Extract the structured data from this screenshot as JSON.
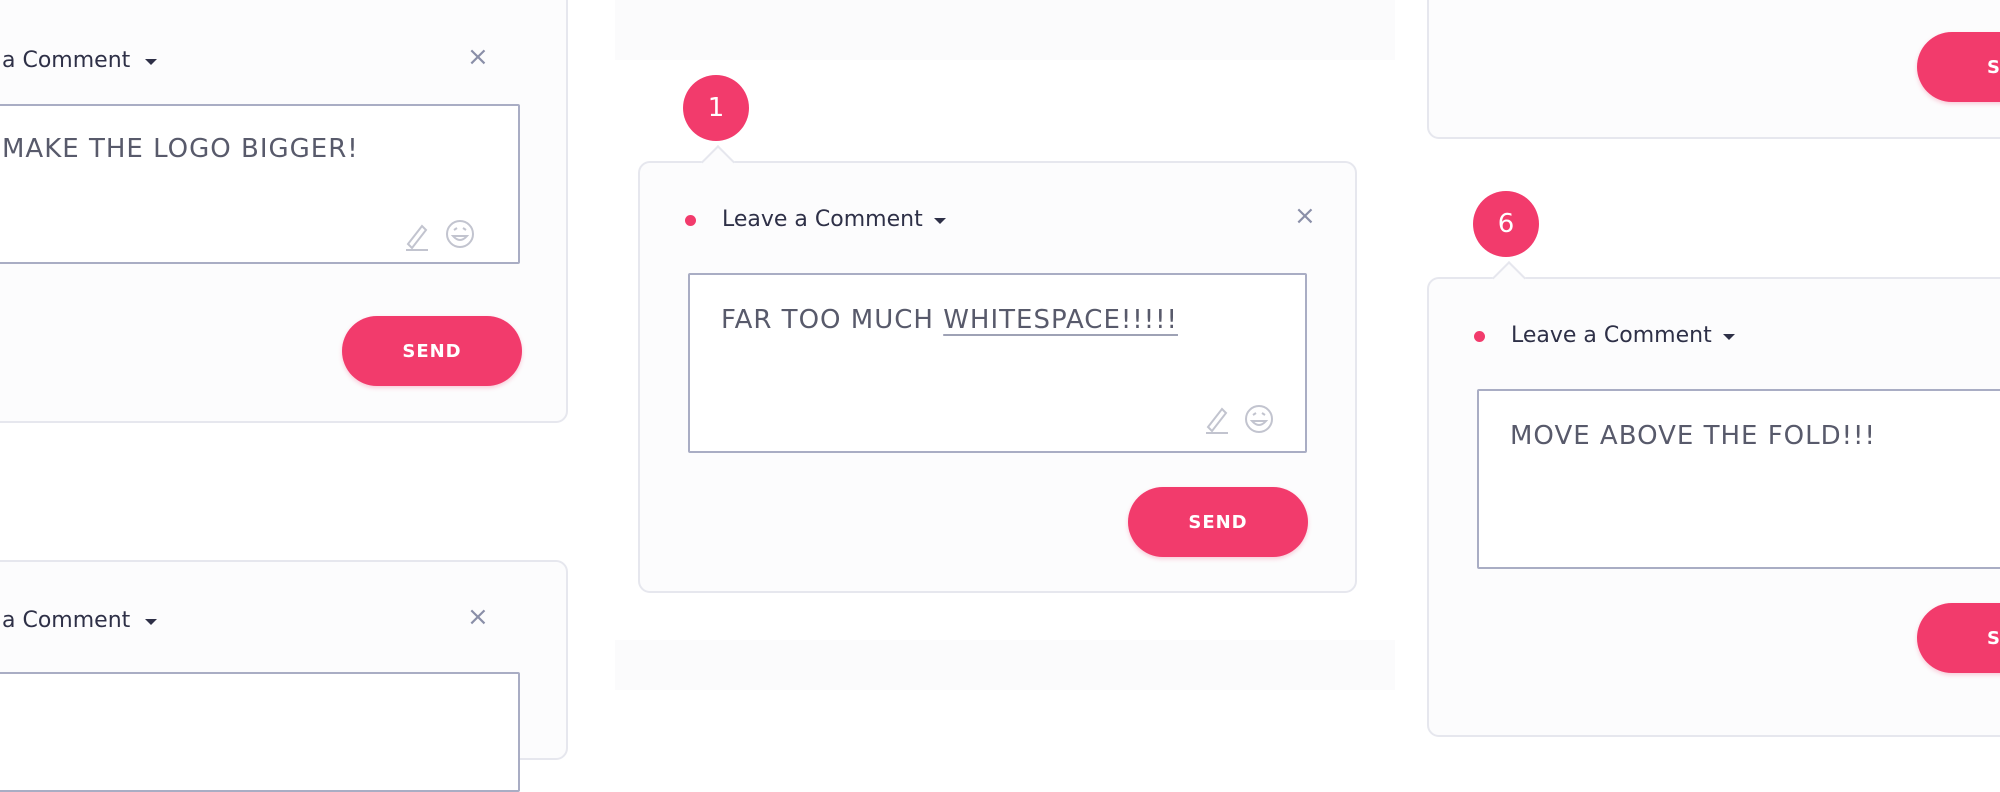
{
  "colors": {
    "accent": "#f23b6c",
    "text": "#2e3047",
    "muted_text": "#585a6b",
    "border": "#e6e7ee"
  },
  "cards": [
    {
      "badge": "",
      "title": "a Comment",
      "comment": "MAKE THE LOGO BIGGER!",
      "send_label": "SEND",
      "close_icon": "×",
      "tools": [
        "pen-icon",
        "emoji-icon"
      ]
    },
    {
      "badge": "",
      "title": "a Comment",
      "close_icon": "×"
    },
    {
      "badge": "1",
      "title": "Leave a Comment",
      "comment_prefix": "FAR TOO MUCH ",
      "comment_underlined": "WHITESPACE!!!!!",
      "send_label": "SEND",
      "close_icon": "×",
      "tools": [
        "pen-icon",
        "emoji-icon"
      ]
    },
    {
      "badge": "",
      "send_label": "SE"
    },
    {
      "badge": "6",
      "title": "Leave a Comment",
      "comment": "MOVE ABOVE THE FOLD!!!",
      "send_label": "SE"
    }
  ]
}
